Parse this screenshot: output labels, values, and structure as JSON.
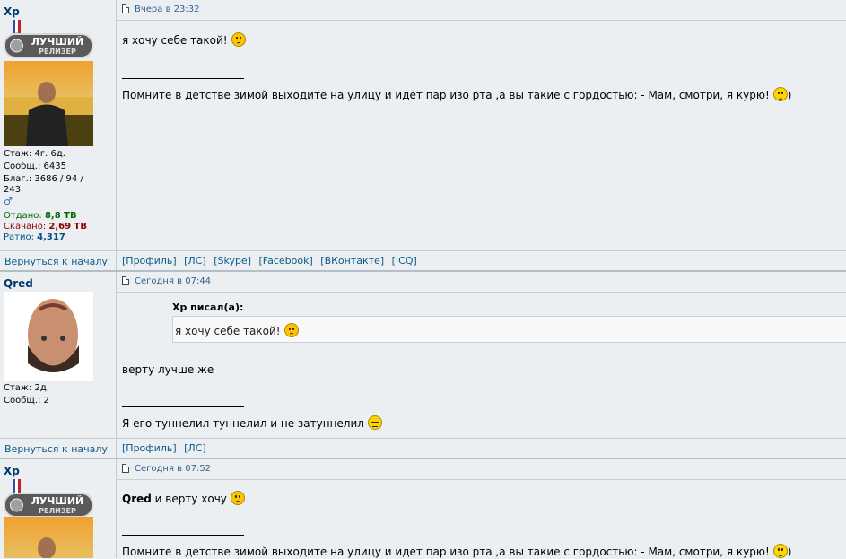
{
  "posts": [
    {
      "author": "Xp",
      "badge": {
        "line1": "ЛУЧШИЙ",
        "line2": "РЕЛИЗЕР"
      },
      "stats": {
        "stage": "Стаж: 4г. 6д.",
        "messages": "Сообщ.: 6435",
        "thanks": "Благ.: 3686 / 94 /",
        "thanks2": "243",
        "gender_icon": "male-icon",
        "given_label": "Отдано:",
        "given_value": "8,8 TB",
        "downloaded_label": "Скачано:",
        "downloaded_value": "2,69 TB",
        "ratio_label": "Ратио:",
        "ratio_value": "4,317"
      },
      "date": "Вчера в 23:32",
      "text": "я хочу себе такой!",
      "signature": "Помните в детстве зимой выходите на улицу и идет пар изо рта ,а вы такие с гордостью: - Мам, смотри, я курю!",
      "signature_tail": ")",
      "footer_back": "Вернуться к началу",
      "footer_links": [
        "[Профиль]",
        "[ЛС]",
        "[Skype]",
        "[Facebook]",
        "[ВКонтакте]",
        "[ICQ]"
      ]
    },
    {
      "author": "Qred",
      "stats": {
        "stage": "Стаж: 2д.",
        "messages": "Сообщ.: 2"
      },
      "date": "Сегодня в 07:44",
      "quote_author": "Xp писал(а):",
      "quote_text": "я хочу себе такой!",
      "text": "верту лучше же",
      "signature": "Я его туннелил туннелил и не затуннелил",
      "footer_back": "Вернуться к началу",
      "footer_links": [
        "[Профиль]",
        "[ЛС]"
      ]
    },
    {
      "author": "Xp",
      "badge": {
        "line1": "ЛУЧШИЙ",
        "line2": "РЕЛИЗЕР"
      },
      "date": "Сегодня в 07:52",
      "mention": "Qred",
      "text": " и верту хочу",
      "signature": "Помните в детстве зимой выходите на улицу и идет пар изо рта ,а вы такие с гордостью: - Мам, смотри, я курю!",
      "signature_tail": ")"
    }
  ]
}
